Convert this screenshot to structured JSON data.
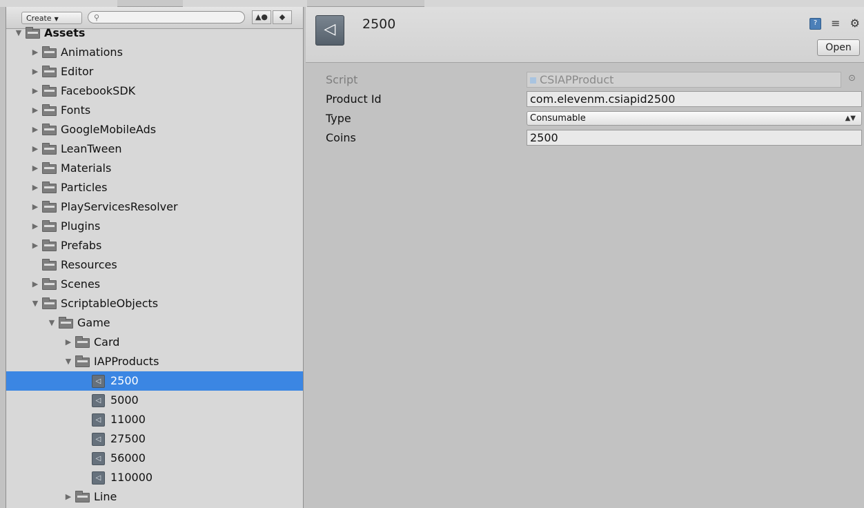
{
  "project": {
    "create_label": "Create",
    "search_placeholder": "",
    "tree": [
      {
        "label": "Assets",
        "depth": 0,
        "expanded": true,
        "type": "folder",
        "bold": true
      },
      {
        "label": "Animations",
        "depth": 1,
        "expanded": false,
        "type": "folder"
      },
      {
        "label": "Editor",
        "depth": 1,
        "expanded": false,
        "type": "folder"
      },
      {
        "label": "FacebookSDK",
        "depth": 1,
        "expanded": false,
        "type": "folder"
      },
      {
        "label": "Fonts",
        "depth": 1,
        "expanded": false,
        "type": "folder"
      },
      {
        "label": "GoogleMobileAds",
        "depth": 1,
        "expanded": false,
        "type": "folder"
      },
      {
        "label": "LeanTween",
        "depth": 1,
        "expanded": false,
        "type": "folder"
      },
      {
        "label": "Materials",
        "depth": 1,
        "expanded": false,
        "type": "folder"
      },
      {
        "label": "Particles",
        "depth": 1,
        "expanded": false,
        "type": "folder"
      },
      {
        "label": "PlayServicesResolver",
        "depth": 1,
        "expanded": false,
        "type": "folder"
      },
      {
        "label": "Plugins",
        "depth": 1,
        "expanded": false,
        "type": "folder"
      },
      {
        "label": "Prefabs",
        "depth": 1,
        "expanded": false,
        "type": "folder"
      },
      {
        "label": "Resources",
        "depth": 1,
        "expanded": null,
        "type": "folder"
      },
      {
        "label": "Scenes",
        "depth": 1,
        "expanded": false,
        "type": "folder"
      },
      {
        "label": "ScriptableObjects",
        "depth": 1,
        "expanded": true,
        "type": "folder"
      },
      {
        "label": "Game",
        "depth": 2,
        "expanded": true,
        "type": "folder"
      },
      {
        "label": "Card",
        "depth": 3,
        "expanded": false,
        "type": "folder"
      },
      {
        "label": "IAPProducts",
        "depth": 3,
        "expanded": true,
        "type": "folder"
      },
      {
        "label": "2500",
        "depth": 4,
        "type": "asset",
        "selected": true
      },
      {
        "label": "5000",
        "depth": 4,
        "type": "asset"
      },
      {
        "label": "11000",
        "depth": 4,
        "type": "asset"
      },
      {
        "label": "27500",
        "depth": 4,
        "type": "asset"
      },
      {
        "label": "56000",
        "depth": 4,
        "type": "asset"
      },
      {
        "label": "110000",
        "depth": 4,
        "type": "asset"
      },
      {
        "label": "Line",
        "depth": 3,
        "expanded": false,
        "type": "folder"
      }
    ]
  },
  "inspector": {
    "title": "2500",
    "open_label": "Open",
    "fields": {
      "script": {
        "label": "Script",
        "value": "CSIAPProduct"
      },
      "product_id": {
        "label": "Product Id",
        "value": "com.elevenm.csiapid2500"
      },
      "type": {
        "label": "Type",
        "value": "Consumable"
      },
      "coins": {
        "label": "Coins",
        "value": "2500"
      }
    }
  },
  "colors": {
    "selection": "#3b86e3",
    "panel_bg": "#c2c2c2"
  }
}
